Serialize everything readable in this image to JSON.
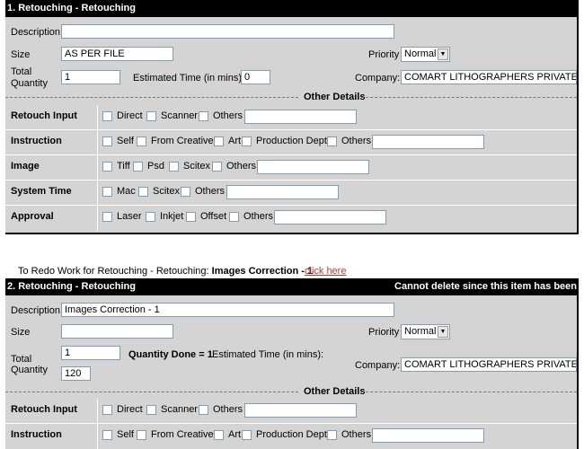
{
  "section1": {
    "header": "1. Retouching - Retouching",
    "description_label": "Description",
    "description_value": "",
    "size_label": "Size",
    "size_value": "AS PER FILE",
    "priority_label": "Priority",
    "priority_value": "Normal",
    "total_qty_label_1": "Total",
    "total_qty_label_2": "Quantity",
    "total_qty_value": "1",
    "est_time_label": "Estimated Time (in mins):",
    "est_time_value": "0",
    "company_label": "Company:",
    "company_value": "COMART LITHOGRAPHERS PRIVATE LIMITED",
    "other_details": "Other Details",
    "rows": [
      {
        "label": "Retouch Input",
        "options": [
          "Direct",
          "Scanner",
          "Others"
        ]
      },
      {
        "label": "Instruction",
        "options": [
          "Self",
          "From Creative",
          "Art",
          "Production Dept",
          "Others"
        ]
      },
      {
        "label": "Image",
        "options": [
          "Tiff",
          "Psd",
          "Scitex",
          "Others"
        ]
      },
      {
        "label": "System Time",
        "options": [
          "Mac",
          "Scitex",
          "Others"
        ]
      },
      {
        "label": "Approval",
        "options": [
          "Laser",
          "Inkjet",
          "Offset",
          "Others"
        ]
      }
    ]
  },
  "redo": {
    "text": "To Redo Work for Retouching - Retouching: ",
    "item": "Images Correction - 1",
    "link": "click here"
  },
  "section2": {
    "header": "2. Retouching - Retouching",
    "header_note": "Cannot delete since this item has been",
    "description_label": "Description",
    "description_value": "Images Correction - 1",
    "size_label": "Size",
    "size_value": "",
    "priority_label": "Priority",
    "priority_value": "Normal",
    "total_qty_label_1": "Total",
    "total_qty_label_2": "Quantity",
    "total_qty_value": "1",
    "qty_done": "Quantity Done = 1",
    "est_time_label": "Estimated Time (in mins):",
    "est_time_value": "120",
    "company_label": "Company:",
    "company_value": "COMART LITHOGRAPHERS PRIVATE LIMITED",
    "other_details": "Other Details",
    "rows": [
      {
        "label": "Retouch Input",
        "options": [
          "Direct",
          "Scanner",
          "Others"
        ]
      },
      {
        "label": "Instruction",
        "options": [
          "Self",
          "From Creative",
          "Art",
          "Production Dept",
          "Others"
        ]
      }
    ]
  }
}
